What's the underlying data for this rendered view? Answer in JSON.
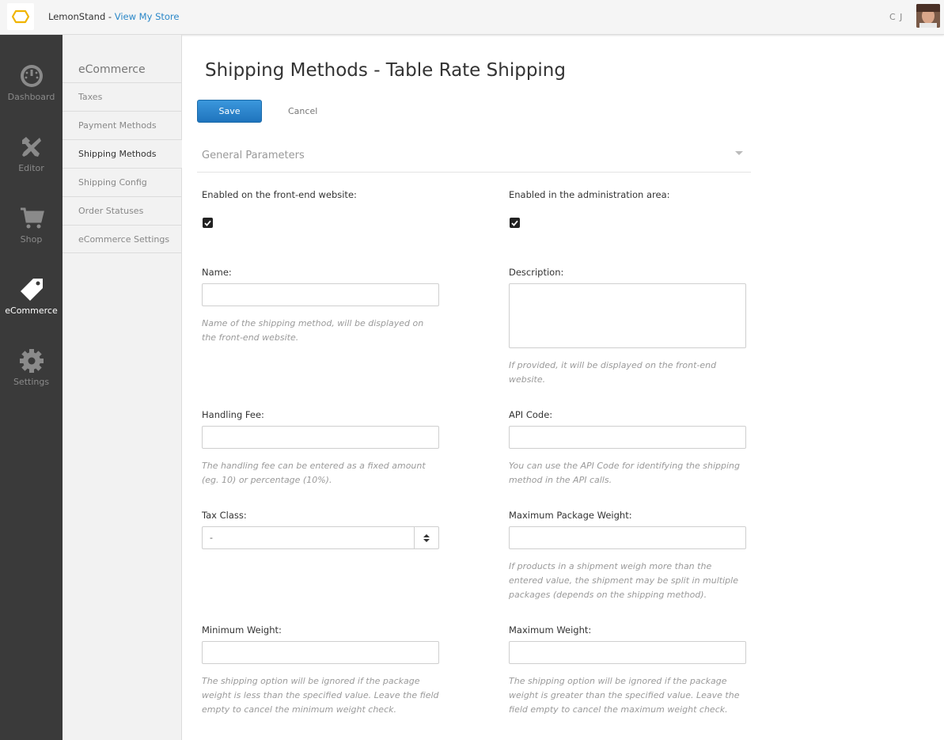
{
  "topbar": {
    "brand_name": "LemonStand",
    "separator": " - ",
    "store_link": "View My Store",
    "user_initials": "C J"
  },
  "sidebar": {
    "items": [
      {
        "label": "Dashboard",
        "icon": "dashboard-icon"
      },
      {
        "label": "Editor",
        "icon": "editor-icon"
      },
      {
        "label": "Shop",
        "icon": "cart-icon"
      },
      {
        "label": "eCommerce",
        "icon": "tag-icon",
        "active": true
      },
      {
        "label": "Settings",
        "icon": "gear-icon"
      }
    ]
  },
  "subnav": {
    "title": "eCommerce",
    "items": [
      {
        "label": "Taxes"
      },
      {
        "label": "Payment Methods"
      },
      {
        "label": "Shipping Methods",
        "active": true
      },
      {
        "label": "Shipping Config"
      },
      {
        "label": "Order Statuses"
      },
      {
        "label": "eCommerce Settings"
      }
    ]
  },
  "main": {
    "title": "Shipping Methods - Table Rate Shipping",
    "save_label": "Save",
    "cancel_label": "Cancel",
    "section_label": "General Parameters",
    "fields": {
      "enabled_frontend": {
        "label": "Enabled on the front-end website:",
        "checked": true
      },
      "enabled_admin": {
        "label": "Enabled in the administration area:",
        "checked": true
      },
      "name": {
        "label": "Name:",
        "value": "",
        "help": "Name of the shipping method, will be displayed on the front-end website."
      },
      "description": {
        "label": "Description:",
        "value": "",
        "help": "If provided, it will be displayed on the front-end website."
      },
      "handling_fee": {
        "label": "Handling Fee:",
        "value": "",
        "help": "The handling fee can be entered as a fixed amount (eg. 10) or percentage (10%)."
      },
      "api_code": {
        "label": "API Code:",
        "value": "",
        "help": "You can use the API Code for identifying the shipping method in the API calls."
      },
      "tax_class": {
        "label": "Tax Class:",
        "selected": "-"
      },
      "max_package_weight": {
        "label": "Maximum Package Weight:",
        "value": "",
        "help": "If products in a shipment weigh more than the entered value, the shipment may be split in multiple packages (depends on the shipping method)."
      },
      "min_weight": {
        "label": "Minimum Weight:",
        "value": "",
        "help": "The shipping option will be ignored if the package weight is less than the specified value. Leave the field empty to cancel the minimum weight check."
      },
      "max_weight": {
        "label": "Maximum Weight:",
        "value": "",
        "help": "The shipping option will be ignored if the package weight is greater than the specified value. Leave the field empty to cancel the maximum weight check."
      }
    }
  },
  "colors": {
    "accent": "#2a87c8",
    "sidebar_bg": "#3a3a3a",
    "save_button": "#2a84cc"
  }
}
